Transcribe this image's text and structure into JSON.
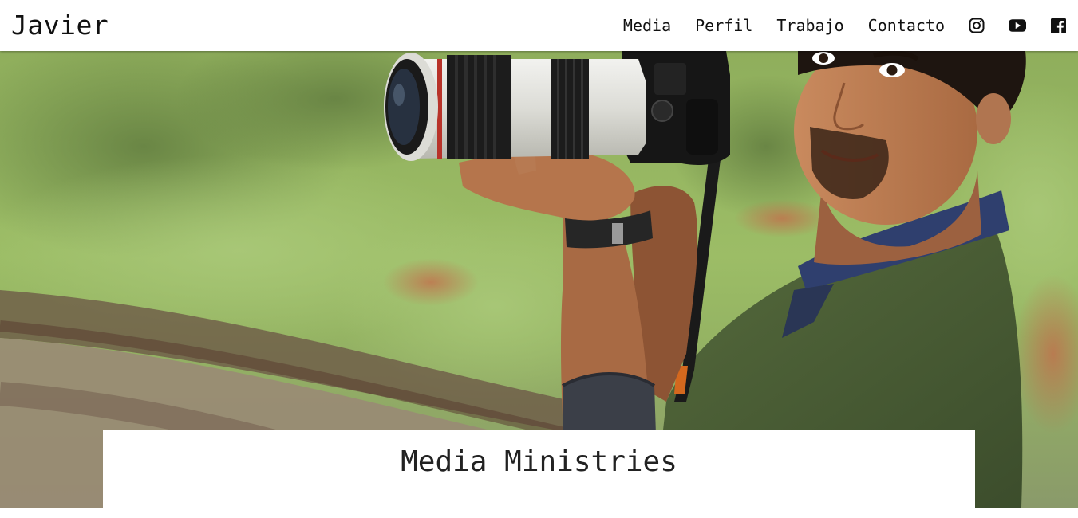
{
  "header": {
    "brand": "Javier",
    "nav": [
      {
        "label": "Media"
      },
      {
        "label": "Perfil"
      },
      {
        "label": "Trabajo"
      },
      {
        "label": "Contacto"
      }
    ],
    "social": [
      {
        "icon": "instagram-icon"
      },
      {
        "icon": "youtube-icon"
      },
      {
        "icon": "facebook-icon"
      }
    ]
  },
  "hero": {
    "image": "photographer-with-camera"
  },
  "card": {
    "title": "Media Ministries"
  },
  "colors": {
    "text": "#111111",
    "background": "#ffffff"
  }
}
